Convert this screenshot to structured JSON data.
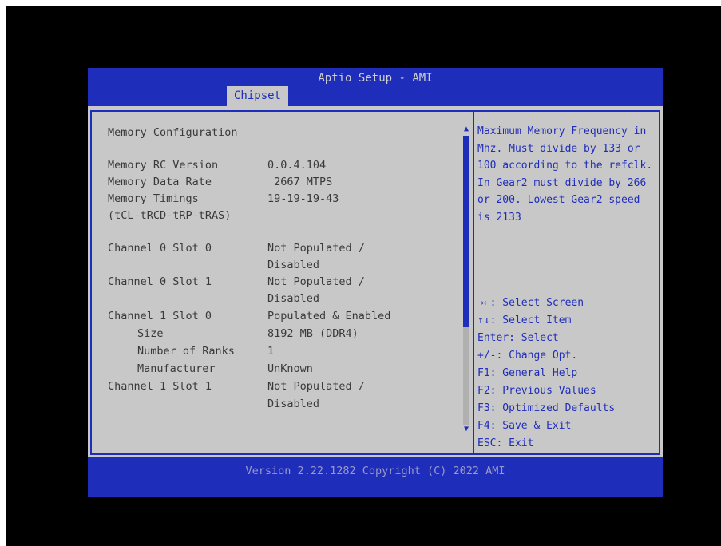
{
  "header": {
    "title": "Aptio Setup - AMI",
    "tabs": [
      {
        "label": "Chipset",
        "active": true
      }
    ]
  },
  "main": {
    "heading": "Memory Configuration",
    "rows": [
      {
        "label": "Memory RC Version",
        "value": "0.0.4.104"
      },
      {
        "label": "Memory Data Rate",
        "value": " 2667 MTPS"
      },
      {
        "label": "Memory Timings",
        "value": "19-19-19-43"
      },
      {
        "label": "(tCL-tRCD-tRP-tRAS)",
        "value": ""
      },
      {
        "label": "Channel 0 Slot 0",
        "value": "Not Populated /"
      },
      {
        "label": "",
        "value": "Disabled"
      },
      {
        "label": "Channel 0 Slot 1",
        "value": "Not Populated /"
      },
      {
        "label": "",
        "value": "Disabled"
      },
      {
        "label": "Channel 1 Slot 0",
        "value": "Populated & Enabled"
      },
      {
        "label": "Size",
        "value": "8192 MB (DDR4)"
      },
      {
        "label": "Number of Ranks",
        "value": "1"
      },
      {
        "label": "Manufacturer",
        "value": "UnKnown"
      },
      {
        "label": "Channel 1 Slot 1",
        "value": "Not Populated /"
      },
      {
        "label": "",
        "value": "Disabled"
      }
    ]
  },
  "help": {
    "text": "Maximum Memory Frequency in Mhz. Must divide by 133 or 100 according to the refclk. In Gear2 must divide by 266 or 200. Lowest Gear2 speed is 2133"
  },
  "keys": [
    "→←: Select Screen",
    "↑↓: Select Item",
    "Enter: Select",
    "+/-: Change Opt.",
    "F1: General Help",
    "F2: Previous Values",
    "F3: Optimized Defaults",
    "F4: Save & Exit",
    "ESC: Exit"
  ],
  "icons": {
    "scroll_up": "▲",
    "scroll_down": "▼"
  },
  "footer": {
    "text": "Version 2.22.1282 Copyright (C) 2022 AMI"
  },
  "colors": {
    "bios_blue": "#1f2dbb",
    "panel_gray": "#c8c8c8",
    "text_gray": "#3a3a3a"
  }
}
